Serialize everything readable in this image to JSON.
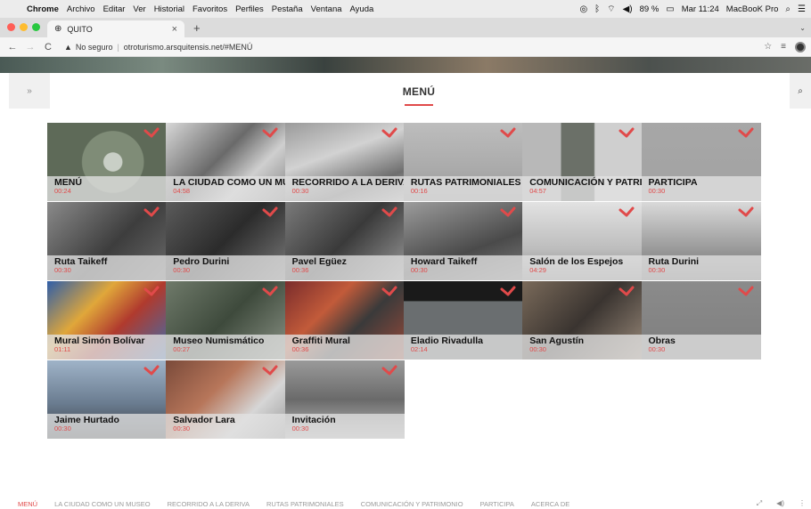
{
  "os_menubar": {
    "apple_icon": "apple-icon",
    "items": [
      "Chrome",
      "Archivo",
      "Editar",
      "Ver",
      "Historial",
      "Favoritos",
      "Perfiles",
      "Pestaña",
      "Ventana",
      "Ayuda"
    ],
    "battery": "89 %",
    "clock": "Mar 11:24",
    "device": "MacBooK Pro"
  },
  "browser": {
    "tab_title": "QUITO",
    "url_warning": "No seguro",
    "url": "otroturismo.arsquitensis.net/#MENÚ"
  },
  "header": {
    "title": "MENÚ"
  },
  "colors": {
    "accent": "#e04a4a",
    "caption_bg": "#e1e1e1"
  },
  "tiles": [
    {
      "name": "MENÚ",
      "time": "00:24",
      "active": true
    },
    {
      "name": "LA CIUDAD COMO UN MUSEO",
      "time": "04:58"
    },
    {
      "name": "RECORRIDO A LA DERIVA",
      "time": "00:30"
    },
    {
      "name": "RUTAS PATRIMONIALES",
      "time": "00:16"
    },
    {
      "name": "COMUNICACIÓN Y PATRIMONIO",
      "time": "04:57"
    },
    {
      "name": "PARTICIPA",
      "time": "00:30"
    },
    {
      "name": "Ruta Taikeff",
      "time": "00:30"
    },
    {
      "name": "Pedro Durini",
      "time": "00:30"
    },
    {
      "name": "Pavel Egüez",
      "time": "00:36"
    },
    {
      "name": "Howard Taikeff",
      "time": "00:30"
    },
    {
      "name": "Salón de los Espejos",
      "time": "04:29"
    },
    {
      "name": "Ruta Durini",
      "time": "00:30"
    },
    {
      "name": "Mural Simón Bolívar",
      "time": "01:11"
    },
    {
      "name": "Museo Numismático",
      "time": "00:27"
    },
    {
      "name": "Graffiti Mural",
      "time": "00:36"
    },
    {
      "name": "Eladio Rivadulla",
      "time": "02:14"
    },
    {
      "name": "San Agustín",
      "time": "00:30"
    },
    {
      "name": "Obras",
      "time": "00:30"
    },
    {
      "name": "Jaime Hurtado",
      "time": "00:30"
    },
    {
      "name": "Salvador Lara",
      "time": "00:30"
    },
    {
      "name": "Invitación",
      "time": "00:30"
    }
  ],
  "footer": {
    "links": [
      "MENÚ",
      "LA CIUDAD COMO UN MUSEO",
      "RECORRIDO A LA DERIVA",
      "RUTAS PATRIMONIALES",
      "COMUNICACIÓN Y PATRIMONIO",
      "PARTICIPA",
      "ACERCA DE"
    ]
  }
}
